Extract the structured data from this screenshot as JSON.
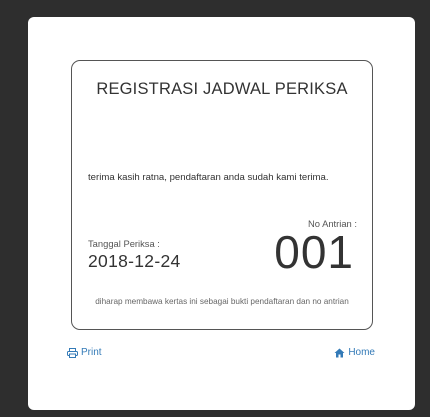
{
  "ticket": {
    "title": "REGISTRASI JADWAL PERIKSA",
    "greeting": "terima kasih ratna, pendaftaran anda sudah kami terima.",
    "queue_label": "No Antrian :",
    "queue_number": "001",
    "date_label": "Tanggal Periksa :",
    "date_value": "2018-12-24",
    "note": "diharap membawa kertas ini sebagai bukti pendaftaran dan no antrian"
  },
  "actions": {
    "print_label": "Print",
    "home_label": "Home",
    "print_icon": "print-icon",
    "home_icon": "home-icon"
  },
  "colors": {
    "link": "#337ab7",
    "backdrop": "#2e2e2e",
    "border": "#555555"
  }
}
